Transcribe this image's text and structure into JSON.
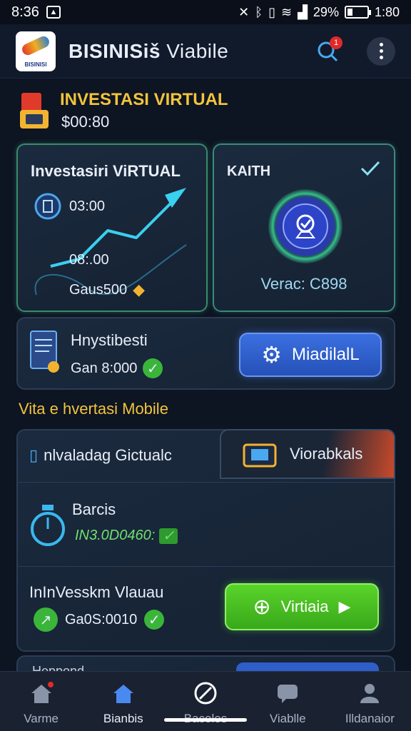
{
  "status": {
    "time": "8:36",
    "battery": "29%",
    "clock_right": "1:80"
  },
  "header": {
    "title_bold": "BISINISiš",
    "title_rest": " Viabile",
    "notification_count": "1"
  },
  "invest_head": {
    "title": "INVESTASI VIRTUAL",
    "value": "$00:80"
  },
  "card_chart": {
    "title": "Investasiri ViRTUAL",
    "value1": "03:00",
    "value2": "08:.00",
    "value3": "Gaus500"
  },
  "card_kaith": {
    "title": "KAITH",
    "label": "Verac: C898"
  },
  "card_hnystibesti": {
    "title": "Hnystibesti",
    "value": "Gan 8:000",
    "button_label": "MiadilalL"
  },
  "section": {
    "label": "Vita e hvertasi Mobile"
  },
  "card_list": {
    "tab_left": "nlvaladag Gictualc",
    "tab_right": "Viorabkals",
    "item1_name": "Barcis",
    "item1_value": "IN3.0D0460:",
    "item2_name": "InInVesskm Vlauau",
    "item2_value": "Ga0S:0010",
    "button_label": "Virtiaia"
  },
  "card_peek": {
    "text": "Heppond"
  },
  "bottom_nav": {
    "items": [
      {
        "label": "Varme",
        "icon": "home-icon"
      },
      {
        "label": "Bianbis",
        "icon": "house-icon"
      },
      {
        "label": "Bacoles",
        "icon": "compass-icon"
      },
      {
        "label": "Viablle",
        "icon": "chat-icon"
      },
      {
        "label": "Illdanaior",
        "icon": "profile-icon"
      }
    ],
    "active_index": 1
  },
  "colors": {
    "background": "#0d1422",
    "accent_yellow": "#f2c43c",
    "accent_blue": "#2f5ec8",
    "accent_green": "#4cc02a",
    "accent_teal": "#3ab8a0"
  }
}
